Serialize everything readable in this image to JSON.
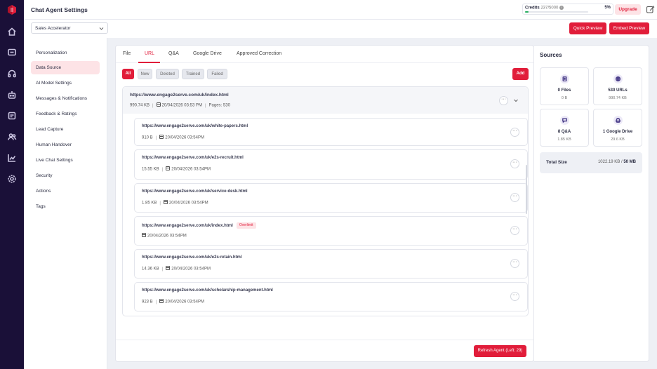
{
  "app": {
    "title": "Chat Agent Settings"
  },
  "credits": {
    "label": "Credits",
    "used_total": "237/5000",
    "percent": "5%",
    "progress_fraction": 0.05
  },
  "header": {
    "upgrade_label": "Upgrade"
  },
  "agent_select": {
    "value": "Sales Accelerator"
  },
  "actions": {
    "quick_preview": "Quick Preview",
    "embed_preview": "Embed Preview"
  },
  "nav": {
    "items": [
      {
        "label": "Personalization"
      },
      {
        "label": "Data Source"
      },
      {
        "label": "AI Model Settings"
      },
      {
        "label": "Messages & Notifications"
      },
      {
        "label": "Feedback & Ratings"
      },
      {
        "label": "Lead Capture"
      },
      {
        "label": "Human Handover"
      },
      {
        "label": "Live Chat Settings"
      },
      {
        "label": "Security"
      },
      {
        "label": "Actions"
      },
      {
        "label": "Tags"
      }
    ],
    "active": "Data Source"
  },
  "tabs": [
    {
      "label": "File"
    },
    {
      "label": "URL"
    },
    {
      "label": "Q&A"
    },
    {
      "label": "Google Drive"
    },
    {
      "label": "Approved Correction"
    }
  ],
  "active_tab": "URL",
  "filters": [
    {
      "label": "All"
    },
    {
      "label": "New"
    },
    {
      "label": "Deleted"
    },
    {
      "label": "Trained"
    },
    {
      "label": "Failed"
    }
  ],
  "add_label": "Add",
  "group": {
    "url": "https://www.engage2serve.com/uk/index.html",
    "size": "990.74 KB",
    "date": "20/04/2026 03:53 PM",
    "pages": "Pages: 530"
  },
  "rows": [
    {
      "url": "https://www.engage2serve.com/uk/white-papers.html",
      "size": "910 B",
      "date": "20/04/2026 03:54PM",
      "badge": ""
    },
    {
      "url": "https://www.engage2serve.com/uk/e2s-recruit.html",
      "size": "15.55 KB",
      "date": "20/04/2026 03:54PM",
      "badge": ""
    },
    {
      "url": "https://www.engage2serve.com/uk/service-desk.html",
      "size": "1.85 KB",
      "date": "20/04/2026 03:54PM",
      "badge": ""
    },
    {
      "url": "https://www.engage2serve.com/uk/index.html",
      "size": "",
      "date": "20/04/2026 03:54PM",
      "badge": "Overlimit"
    },
    {
      "url": "https://www.engage2serve.com/uk/e2s-retain.html",
      "size": "14.36 KB",
      "date": "20/04/2026 03:54PM",
      "badge": ""
    },
    {
      "url": "https://www.engage2serve.com/uk/scholarship-management.html",
      "size": "923 B",
      "date": "20/04/2026 03:54PM",
      "badge": ""
    }
  ],
  "refresh_label": "Refresh Agent (Left: 29)",
  "sources": {
    "title": "Sources",
    "cards": [
      {
        "label": "0 Files",
        "size": "0 B",
        "icon": "file-icon"
      },
      {
        "label": "530 URLs",
        "size": "990.74 KB",
        "icon": "globe-icon"
      },
      {
        "label": "8 Q&A",
        "size": "1.85 KB",
        "icon": "chat-icon"
      },
      {
        "label": "1 Google Drive",
        "size": "29.6 KB",
        "icon": "drive-icon"
      }
    ],
    "total_label": "Total Size",
    "total_used": "1022.19 KB",
    "total_limit": "50 MB"
  },
  "colors": {
    "accent": "#e11d3a",
    "rail": "#1a1038",
    "progress": "#27ae60"
  }
}
